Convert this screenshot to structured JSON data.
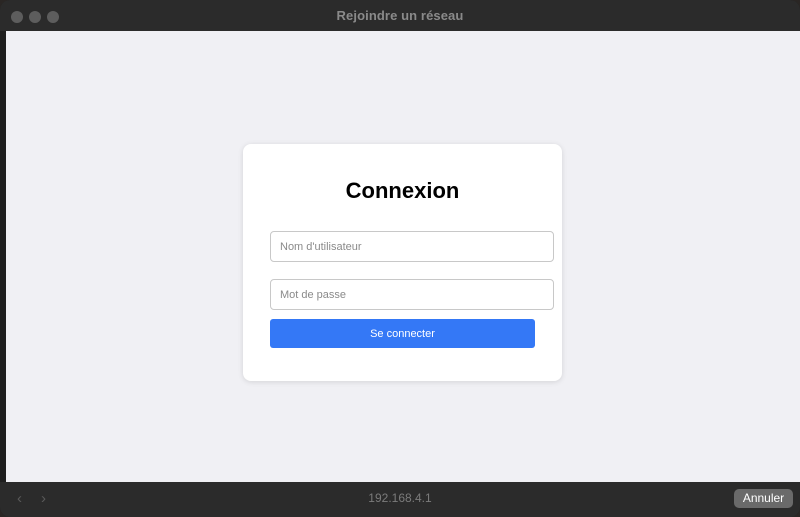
{
  "window": {
    "title": "Rejoindre un réseau"
  },
  "login": {
    "heading": "Connexion",
    "username_placeholder": "Nom d'utilisateur",
    "password_placeholder": "Mot de passe",
    "submit_label": "Se connecter"
  },
  "footer": {
    "address": "192.168.4.1",
    "back_icon": "chevron-left-icon",
    "forward_icon": "chevron-right-icon",
    "back_glyph": "‹",
    "forward_glyph": "›",
    "cancel_label": "Annuler"
  },
  "colors": {
    "accent": "#3478f6",
    "content_background": "#f0f0f4",
    "chrome": "#2b2b2b"
  }
}
